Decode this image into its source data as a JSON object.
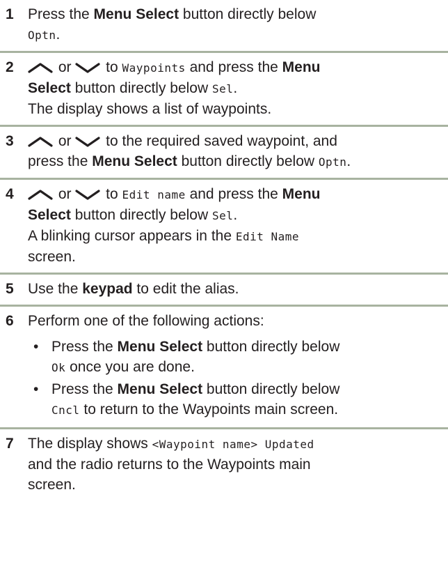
{
  "steps": [
    {
      "num": "1",
      "t1": "Press the ",
      "b1": "Menu Select",
      "t2": " button directly below",
      "m1": "Optn",
      "t3": "."
    },
    {
      "num": "2",
      "or": " or ",
      "t1": " to ",
      "m1": "Waypoints",
      "t2": " and press the ",
      "b1": "Menu",
      "b2": "Select",
      "t3": " button directly below ",
      "m2": "Sel",
      "t4": ".",
      "t5": "The display shows a list of waypoints."
    },
    {
      "num": "3",
      "or": " or ",
      "t1": " to the required saved waypoint, and",
      "t2": "press the ",
      "b1": "Menu Select",
      "t3": " button directly below ",
      "m1": "Optn",
      "t4": "."
    },
    {
      "num": "4",
      "or": " or ",
      "t1": " to ",
      "m1": "Edit name",
      "t2": " and press the ",
      "b1": "Menu",
      "b2": "Select",
      "t3": " button directly below ",
      "m2": "Sel",
      "t4": ".",
      "t5": "A blinking cursor appears in the ",
      "m3": "Edit Name",
      "t6": "screen."
    },
    {
      "num": "5",
      "t1": "Use the ",
      "b1": "keypad",
      "t2": " to edit the alias."
    },
    {
      "num": "6",
      "t1": "Perform one of the following actions:",
      "bullets": [
        {
          "dot": "•",
          "t1": "Press the ",
          "b1": "Menu Select",
          "t2": " button directly below",
          "m1": "Ok",
          "t3": " once you are done."
        },
        {
          "dot": "•",
          "t1": "Press the ",
          "b1": "Menu Select",
          "t2": " button directly below",
          "m1": "Cncl",
          "t3": " to return to the Waypoints main screen."
        }
      ]
    },
    {
      "num": "7",
      "t1": "The display shows ",
      "m1": "<Waypoint name> Updated",
      "t2": "and the radio returns to the Waypoints main",
      "t3": "screen."
    }
  ],
  "icons": {
    "up": "chevron-up-icon",
    "down": "chevron-down-icon"
  },
  "colors": {
    "rule": "#a8b3a0",
    "text": "#231f20"
  }
}
